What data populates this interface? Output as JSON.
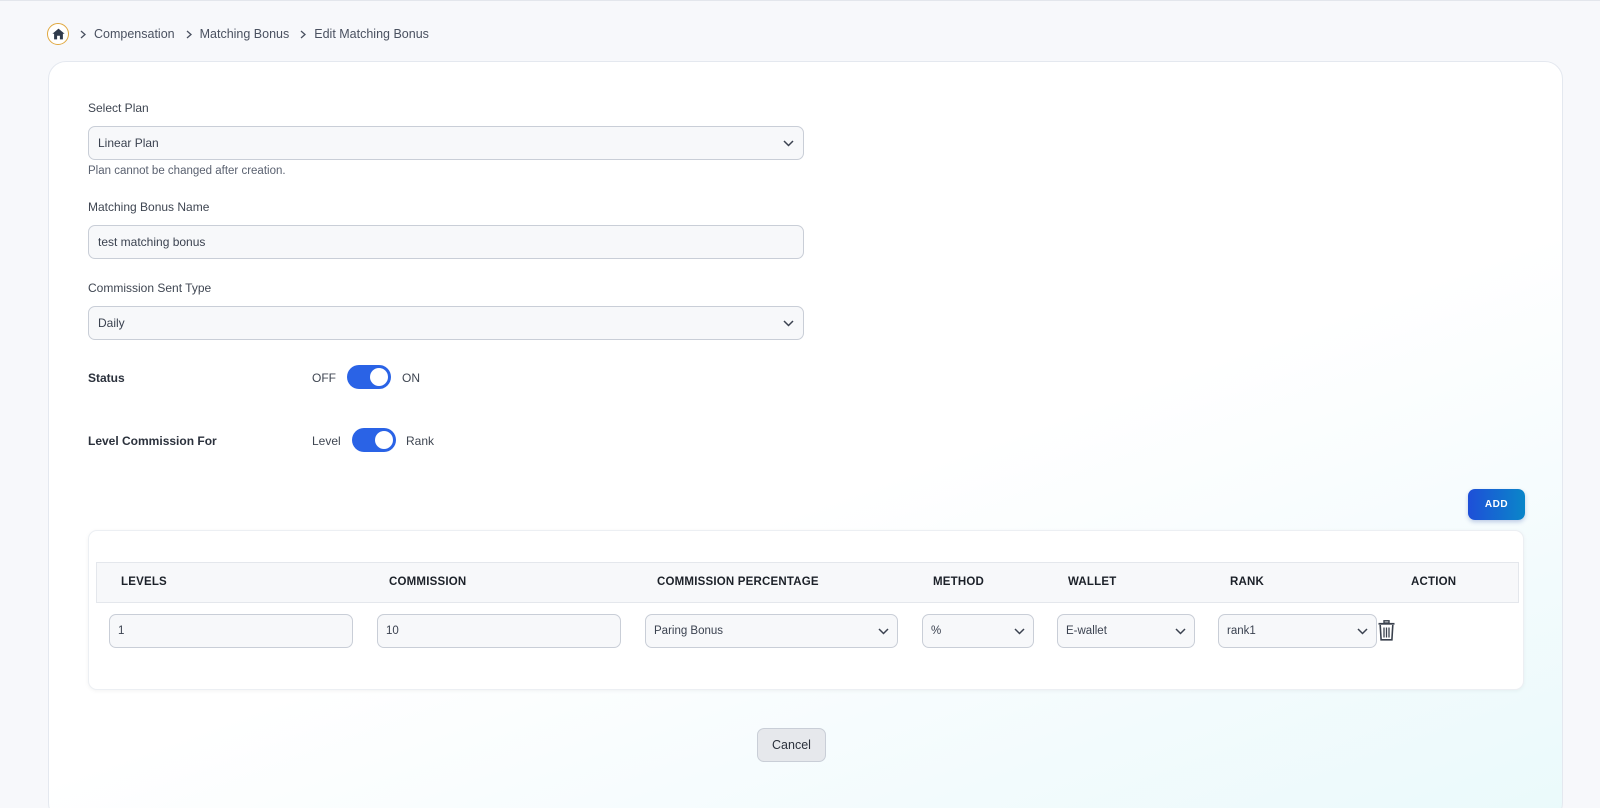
{
  "breadcrumb": {
    "items": [
      "Compensation",
      "Matching Bonus",
      "Edit Matching Bonus"
    ]
  },
  "form": {
    "select_plan": {
      "label": "Select Plan",
      "value": "Linear Plan",
      "hint": "Plan cannot be changed after creation."
    },
    "bonus_name": {
      "label": "Matching Bonus Name",
      "value": "test matching bonus"
    },
    "commission_sent_type": {
      "label": "Commission Sent Type",
      "value": "Daily"
    },
    "status": {
      "label": "Status",
      "off_label": "OFF",
      "on_label": "ON",
      "enabled": true
    },
    "level_commission_for": {
      "label": "Level Commission For",
      "left_label": "Level",
      "right_label": "Rank",
      "right_selected": true
    }
  },
  "add_button_label": "ADD",
  "table": {
    "headers": [
      "LEVELS",
      "COMMISSION",
      "COMMISSION PERCENTAGE",
      "METHOD",
      "WALLET",
      "RANK",
      "ACTION"
    ],
    "rows": [
      {
        "levels": "1",
        "commission": "10",
        "commission_percentage": "Paring Bonus",
        "method": "%",
        "wallet": "E-wallet",
        "rank": "rank1"
      }
    ]
  },
  "cancel_button_label": "Cancel",
  "colors": {
    "accent": "#2a63e6",
    "home_ring": "#e0a83f",
    "add_gradient_start": "#1e4fd8",
    "add_gradient_end": "#0a86c9"
  },
  "icons": {
    "home": "home-icon",
    "separator": "chevron-right-icon",
    "dropdown": "chevron-down-icon",
    "delete": "trash-icon"
  }
}
